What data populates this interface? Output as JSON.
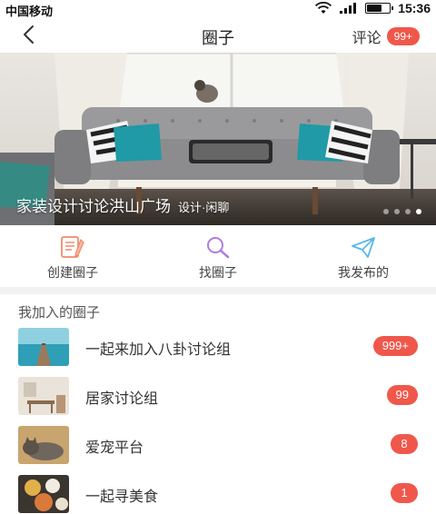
{
  "status_bar": {
    "carrier": "中国移动",
    "time": "15:36",
    "battery_level": 0.65
  },
  "nav": {
    "back_icon": "chevron-left-icon",
    "title": "圈子",
    "comment_label": "评论",
    "comment_badge": "99+"
  },
  "banner": {
    "caption": "家装设计讨论洪山广场",
    "tag": "设计·闲聊",
    "slide_count": 4,
    "active_slide": 4
  },
  "actions": [
    {
      "label": "创建圈子",
      "icon": "notepad-edit-icon",
      "color": "#f08a6a"
    },
    {
      "label": "找圈子",
      "icon": "search-icon",
      "color": "#b07de0"
    },
    {
      "label": "我发布的",
      "icon": "paper-plane-icon",
      "color": "#5ab6e8"
    }
  ],
  "section_title": "我加入的圈子",
  "groups": [
    {
      "name": "一起来加入八卦讨论组",
      "count": "999+",
      "thumb": "pier-sea-image"
    },
    {
      "name": "居家讨论组",
      "count": "99",
      "thumb": "home-interior-image"
    },
    {
      "name": "爱宠平台",
      "count": "8",
      "thumb": "cat-image"
    },
    {
      "name": "一起寻美食",
      "count": "1",
      "thumb": "food-image"
    }
  ],
  "colors": {
    "accent": "#f0574b",
    "text_primary": "#333333",
    "divider": "#f2f2f2"
  }
}
